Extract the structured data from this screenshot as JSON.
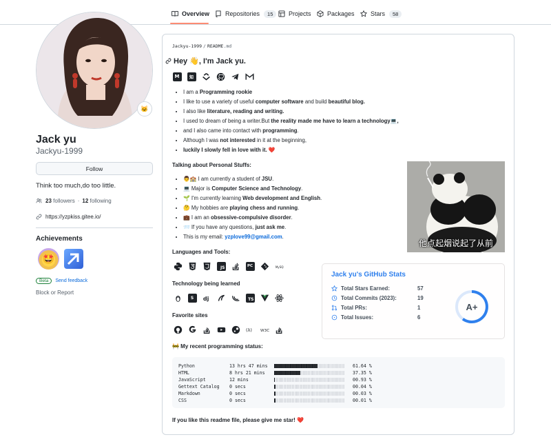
{
  "nav": {
    "tabs": [
      {
        "label": "Overview",
        "icon": "book-icon"
      },
      {
        "label": "Repositories",
        "icon": "repo-icon",
        "count": "15"
      },
      {
        "label": "Projects",
        "icon": "table-icon"
      },
      {
        "label": "Packages",
        "icon": "package-icon"
      },
      {
        "label": "Stars",
        "icon": "star-icon",
        "count": "58"
      }
    ]
  },
  "profile": {
    "full_name": "Jack yu",
    "username": "Jackyu-1999",
    "follow_label": "Follow",
    "bio": "Think too much,do too little.",
    "followers_count": "23",
    "followers_label": "followers",
    "following_count": "12",
    "following_label": "following",
    "link": "https://yzpkiss.gitee.io/",
    "achievements_title": "Achievements",
    "beta_label": "Beta",
    "feedback_label": "Send feedback",
    "block_label": "Block or Report"
  },
  "readme": {
    "path_user": "Jackyu-1999",
    "path_sep": "/",
    "path_file": "README",
    "path_ext": ".md",
    "heading": "Hey 👋, I'm Jack yu.",
    "intro": [
      {
        "pre": "I am a ",
        "bold": "Programming rookie",
        "post": ""
      },
      {
        "pre": "I like to use a variety of useful ",
        "bold": "computer software",
        "mid": " and build ",
        "bold2": "beautiful blog.",
        "post": ""
      },
      {
        "pre": "I also like ",
        "bold": "literature, reading and writing.",
        "post": ""
      },
      {
        "pre": "I used to dream of being a writer.But ",
        "bold": "the reality made me have to learn a technology💻,",
        "post": ""
      },
      {
        "pre": "and I also came into contact with ",
        "bold": "programming",
        "post": "."
      },
      {
        "pre": "Although I was ",
        "bold": "not interested",
        "post": " in it at the beginning,"
      },
      {
        "pre": "",
        "bold": "luckily I slowly fell in love with it.",
        "post": " ❤️"
      }
    ],
    "personal_title": "Talking about Personal Stuffs:",
    "personal": [
      {
        "pre": "👨🏫 I am currently a student of ",
        "bold": "JSU",
        "post": "."
      },
      {
        "pre": "💻 Major is ",
        "bold": "Computer Science and Technology",
        "post": "."
      },
      {
        "pre": "🌱 I'm currently learning ",
        "bold": "Web development and English",
        "post": "."
      },
      {
        "pre": "🤔 My hobbies are ",
        "bold": "playing chess and running",
        "post": "."
      },
      {
        "pre": "💼 I am an ",
        "bold": "obsessive-compulsive disorder",
        "post": "."
      },
      {
        "pre": "📨 If you have any questions, ",
        "bold": "just ask me",
        "post": "."
      },
      {
        "pre": "This is my email: ",
        "email": "yzplove99@gmail.com",
        "post": "."
      }
    ],
    "panda_caption": "他点起烟说起了从前",
    "languages_title": "Languages and Tools:",
    "tech_title": "Technology being learned",
    "sites_title": "Favorite sites",
    "status_title": "🚧 My recent programming status:",
    "footer": "If you like this readme file, please give me star! ❤️"
  },
  "stats": {
    "title": "Jack yu's GitHub Stats",
    "rows": [
      {
        "label": "Total Stars Earned:",
        "value": "57"
      },
      {
        "label": "Total Commits (2023):",
        "value": "19"
      },
      {
        "label": "Total PRs:",
        "value": "1"
      },
      {
        "label": "Total Issues:",
        "value": "6"
      }
    ],
    "grade": "A+",
    "accent": "#2f80ed"
  },
  "coding": [
    {
      "lang": "Python",
      "time": "13 hrs 47 mins",
      "fraction": 0.6164,
      "pct": "61.64 %"
    },
    {
      "lang": "HTML",
      "time": "8 hrs 21 mins",
      "fraction": 0.3735,
      "pct": "37.35 %"
    },
    {
      "lang": "JavaScript",
      "time": "12 mins",
      "fraction": 0.0093,
      "pct": "00.93 %"
    },
    {
      "lang": "Gettext Catalog",
      "time": "0 secs",
      "fraction": 0.0004,
      "pct": "00.04 %"
    },
    {
      "lang": "Markdown",
      "time": "0 secs",
      "fraction": 0.0003,
      "pct": "00.03 %"
    },
    {
      "lang": "CSS",
      "time": "0 secs",
      "fraction": 0.0001,
      "pct": "00.01 %"
    }
  ]
}
